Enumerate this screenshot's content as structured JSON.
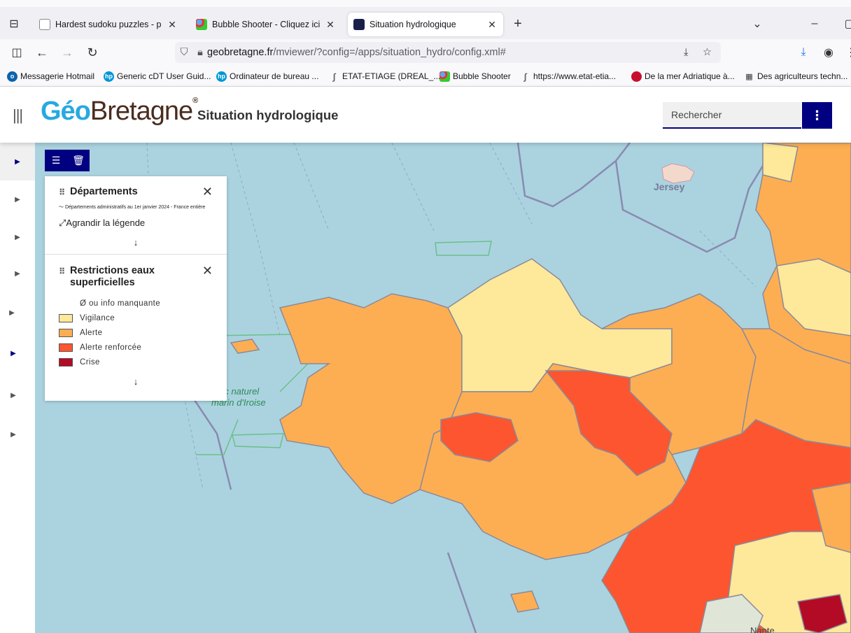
{
  "browser": {
    "tabs": [
      {
        "title": "Hardest sudoku puzzles - play s",
        "close": "✕",
        "favicon_color": "#888888"
      },
      {
        "title": "Bubble Shooter - Cliquez ici po",
        "close": "✕",
        "favicon_color": "#3a7bd5"
      },
      {
        "title": "Situation hydrologique",
        "close": "✕",
        "favicon_color": "#1a1f4a"
      }
    ],
    "new_tab": "+",
    "url_host": "geobretagne.fr",
    "url_path": "/mviewer/?config=/apps/situation_hydro/config.xml#",
    "bookmarks": [
      {
        "label": "Messagerie Hotmail",
        "icon": "outlook-icon",
        "color": "#0a64ad"
      },
      {
        "label": "Generic cDT User Guid...",
        "icon": "hp-icon",
        "color": "#0096d6"
      },
      {
        "label": "Ordinateur de bureau ...",
        "icon": "hp-icon",
        "color": "#0096d6"
      },
      {
        "label": "ETAT-ETIAGE (DREAL_...",
        "icon": "link-icon",
        "color": "#666666"
      },
      {
        "label": "Bubble Shooter",
        "icon": "bubble-icon",
        "color": "#3a7bd5"
      },
      {
        "label": "https://www.etat-etia...",
        "icon": "link-icon",
        "color": "#666666"
      },
      {
        "label": "De la mer Adriatique à...",
        "icon": "red-circle-icon",
        "color": "#c8102e"
      },
      {
        "label": "Des agriculteurs techn...",
        "icon": "news-icon",
        "color": "#333333"
      }
    ]
  },
  "app": {
    "logo_geo": "Géo",
    "logo_bretagne": "Bretagne",
    "logo_reg": "®",
    "title": "Situation hydrologique",
    "search_placeholder": "Rechercher"
  },
  "legend": {
    "sections": [
      {
        "title": "Départements",
        "subtitle": "Départements administratifs au 1er janvier 2024 - France entière",
        "enlarge": "Agrandir la légende"
      },
      {
        "title": "Restrictions eaux superficielles",
        "items": [
          {
            "label": "Ø ou info manquante",
            "color": ""
          },
          {
            "label": "Vigilance",
            "color": "#fee89a"
          },
          {
            "label": "Alerte",
            "color": "#fdae53"
          },
          {
            "label": "Alerte renforcée",
            "color": "#fc5530"
          },
          {
            "label": "Crise",
            "color": "#b30b25"
          }
        ]
      }
    ]
  },
  "map": {
    "labels": {
      "jersey": "Jersey",
      "parc": "rc naturel",
      "parc2": "marin d'Iroise",
      "nantes": "Nante"
    }
  }
}
